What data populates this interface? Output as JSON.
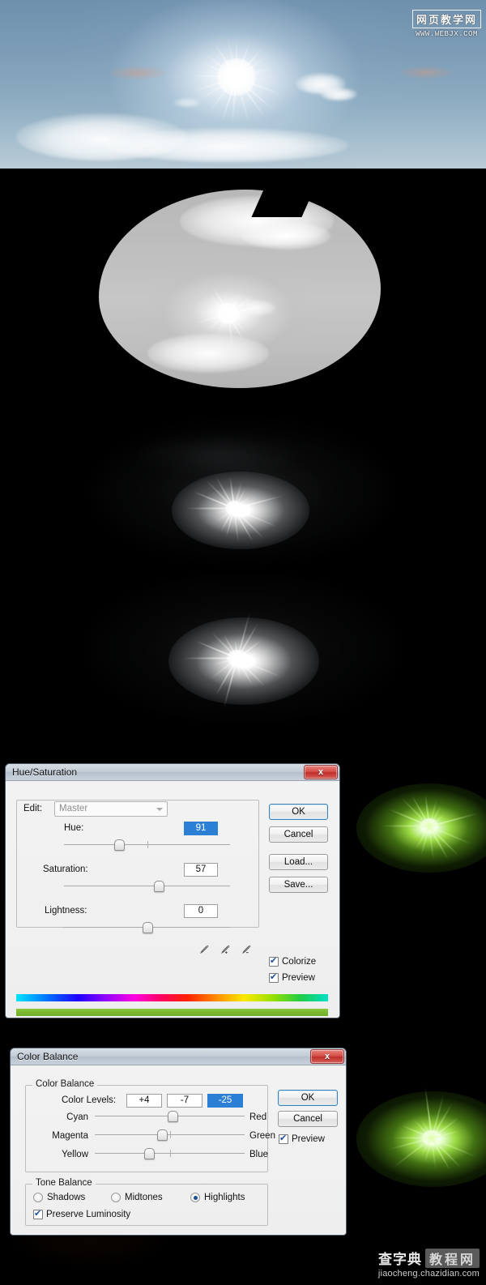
{
  "watermarks": {
    "top": {
      "cn": "网页教学网",
      "url": "WWW.WEBJX.COM"
    },
    "bottom": {
      "cn1": "查字典",
      "cn2": "教程网",
      "url": "jiaocheng.chazidian.com"
    }
  },
  "panels": [
    {
      "name": "original-sky-photo",
      "caption": "Blue sky with sun and clouds"
    },
    {
      "name": "desaturated-oval-selection",
      "caption": "Grayscale oval selection on black"
    },
    {
      "name": "darkened-sun-burst",
      "caption": "Darkened sun starburst"
    },
    {
      "name": "brightened-sun-burst",
      "caption": "Brightened white sun starburst"
    },
    {
      "name": "green-colorized-burst",
      "caption": "Green colorized sun burst"
    },
    {
      "name": "green-balanced-burst",
      "caption": "Color balanced green burst"
    }
  ],
  "hue_saturation_dialog": {
    "title": "Hue/Saturation",
    "close_label": "x",
    "edit_label": "Edit:",
    "edit_value": "Master",
    "sliders": [
      {
        "label": "Hue:",
        "value": "91",
        "selected": true,
        "thumb_pct": 33
      },
      {
        "label": "Saturation:",
        "value": "57",
        "selected": false,
        "thumb_pct": 57
      },
      {
        "label": "Lightness:",
        "value": "0",
        "selected": false,
        "thumb_pct": 50
      }
    ],
    "buttons": [
      {
        "label": "OK",
        "primary": true
      },
      {
        "label": "Cancel",
        "primary": false
      },
      {
        "label": "Load...",
        "primary": false
      },
      {
        "label": "Save...",
        "primary": false
      }
    ],
    "checkboxes": [
      {
        "label": "Colorize",
        "checked": true
      },
      {
        "label": "Preview",
        "checked": true
      }
    ],
    "eyedroppers": [
      "eyedropper-icon",
      "eyedropper-plus-icon",
      "eyedropper-minus-icon"
    ]
  },
  "color_balance_dialog": {
    "title": "Color Balance",
    "close_label": "x",
    "group_label": "Color Balance",
    "color_levels_label": "Color Levels:",
    "color_levels": [
      {
        "value": "+4",
        "selected": false
      },
      {
        "value": "-7",
        "selected": false
      },
      {
        "value": "-25",
        "selected": true
      }
    ],
    "sliders": [
      {
        "left": "Cyan",
        "right": "Red",
        "thumb_pct": 52
      },
      {
        "left": "Magenta",
        "right": "Green",
        "thumb_pct": 45
      },
      {
        "left": "Yellow",
        "right": "Blue",
        "thumb_pct": 36
      }
    ],
    "tone_balance_label": "Tone Balance",
    "tone_options": [
      {
        "label": "Shadows",
        "selected": false
      },
      {
        "label": "Midtones",
        "selected": false
      },
      {
        "label": "Highlights",
        "selected": true
      }
    ],
    "preserve_luminosity": {
      "label": "Preserve Luminosity",
      "checked": true
    },
    "buttons": [
      {
        "label": "OK",
        "primary": true
      },
      {
        "label": "Cancel",
        "primary": false
      }
    ],
    "preview": {
      "label": "Preview",
      "checked": true
    }
  },
  "colors": {
    "accent_blue": "#2b7fd4",
    "close_red": "#bf2f2a",
    "green_glow": "#9ddc46",
    "sky_blue": "#7c9cb6"
  }
}
